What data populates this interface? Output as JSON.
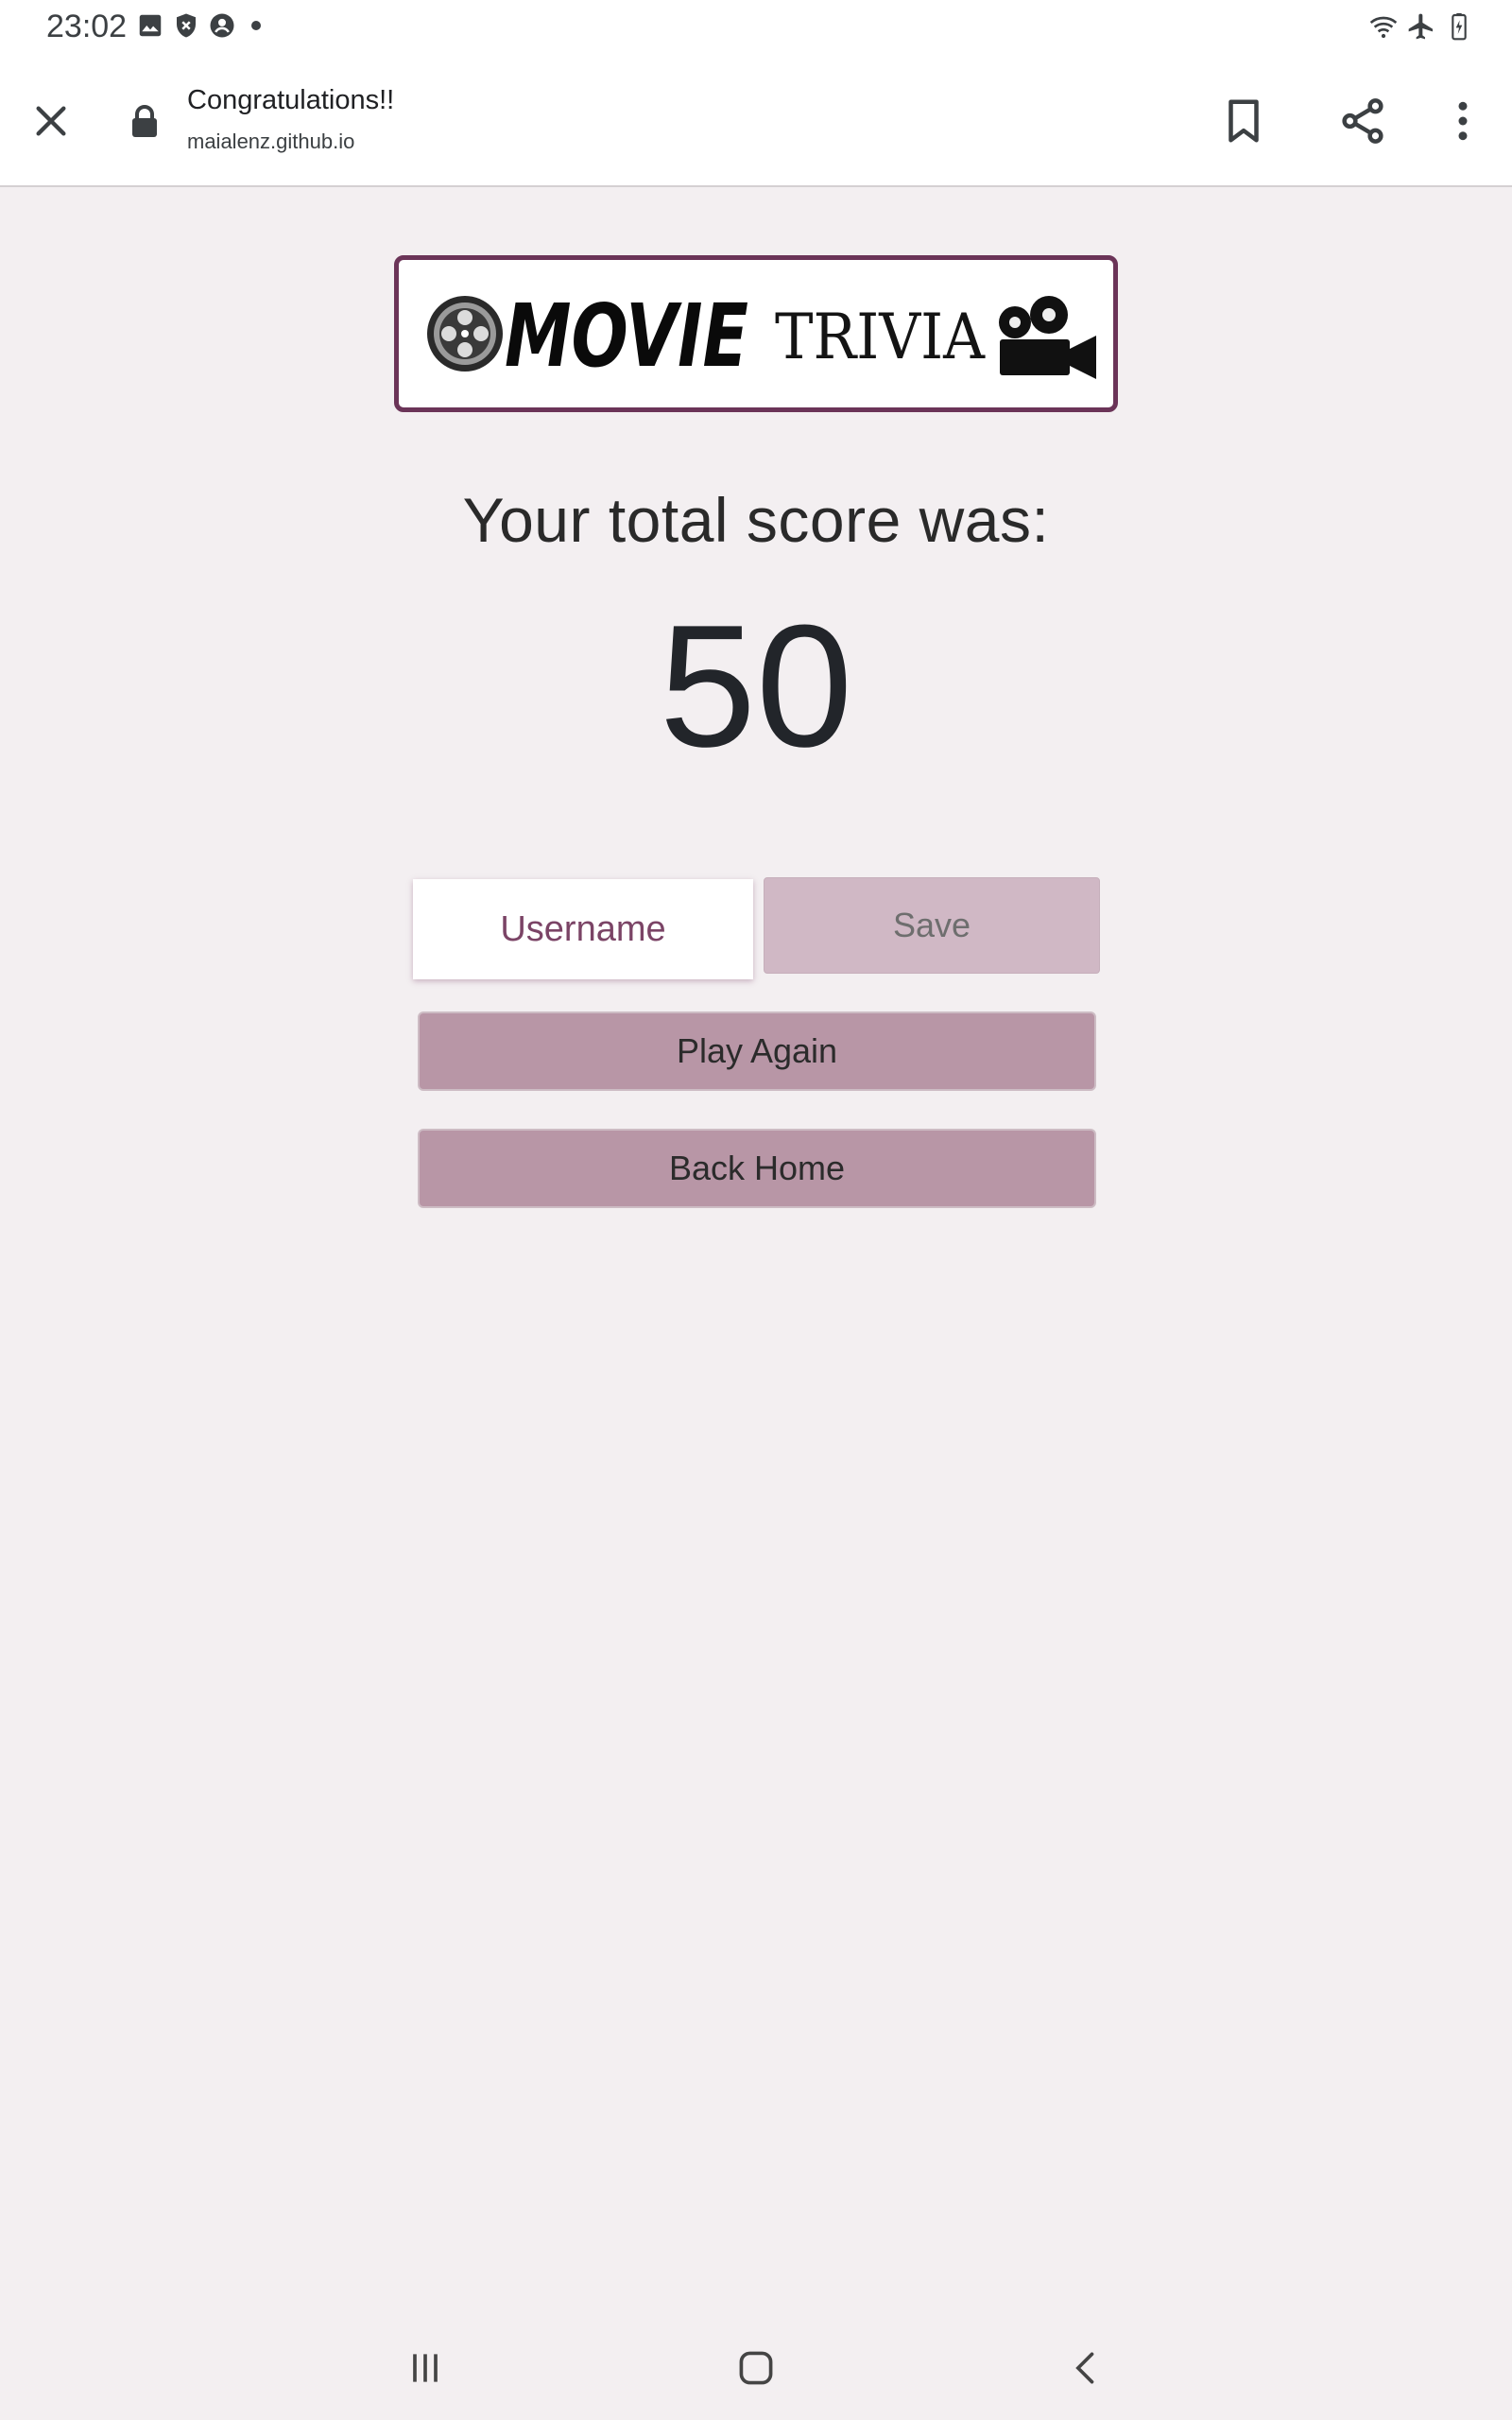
{
  "status_bar": {
    "time": "23:02",
    "left_icons": [
      "image-icon",
      "shield-icon",
      "account-icon",
      "dot-icon"
    ],
    "right_icons": [
      "wifi-icon",
      "airplane-mode-icon",
      "battery-charging-icon"
    ]
  },
  "browser": {
    "page_title": "Congratulations!!",
    "url": "maialenz.github.io",
    "icons": [
      "close-icon",
      "lock-icon",
      "bookmark-icon",
      "share-icon",
      "more-vert-icon"
    ]
  },
  "logo": {
    "text_bold": "MOVIE",
    "text_light": "TRIVIA",
    "border_color": "#6b3458",
    "icons": [
      "film-reel-icon",
      "movie-camera-icon"
    ]
  },
  "results": {
    "score_label": "Your total score was:",
    "score": "50"
  },
  "form": {
    "username_placeholder": "Username",
    "save_label": "Save"
  },
  "actions": {
    "play_again_label": "Play Again",
    "back_home_label": "Back Home"
  },
  "nav_bar": {
    "icons": [
      "recents-icon",
      "home-icon",
      "back-icon"
    ]
  },
  "colors": {
    "background": "#f3eff1",
    "accent": "#6b3458",
    "button": "#b896a6",
    "button_disabled": "#d0b8c5"
  }
}
